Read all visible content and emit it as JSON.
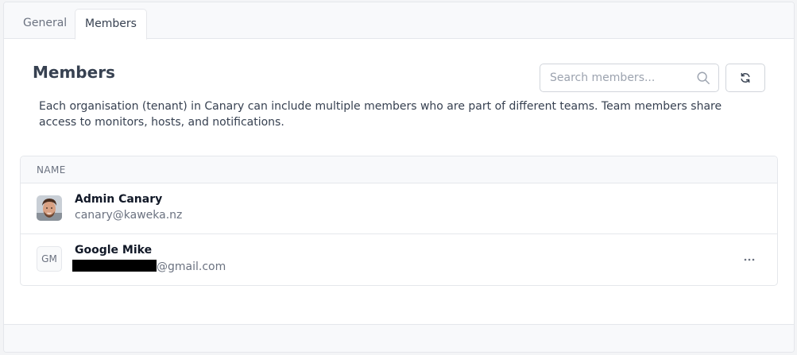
{
  "tabs": [
    {
      "label": "General",
      "active": false
    },
    {
      "label": "Members",
      "active": true
    }
  ],
  "page": {
    "title": "Members",
    "description": "Each organisation (tenant) in Canary can include multiple members who are part of different teams. Team members share access to monitors, hosts, and notifications."
  },
  "search": {
    "value": "",
    "placeholder": "Search members...",
    "icon": "search-icon"
  },
  "refresh": {
    "icon": "refresh-icon"
  },
  "table": {
    "columns": [
      "NAME"
    ],
    "rows": [
      {
        "name": "Admin Canary",
        "email": "canary@kaweka.nz",
        "avatar": "photo"
      },
      {
        "name": "Google Mike",
        "initials": "GM",
        "email_visible": "@gmail.com",
        "email_redacted": true,
        "more_label": "···"
      }
    ]
  },
  "colors": {
    "text": "#374151",
    "muted": "#6b7280",
    "border": "#e5e7eb",
    "tabbar_bg": "#f8f9fb"
  }
}
